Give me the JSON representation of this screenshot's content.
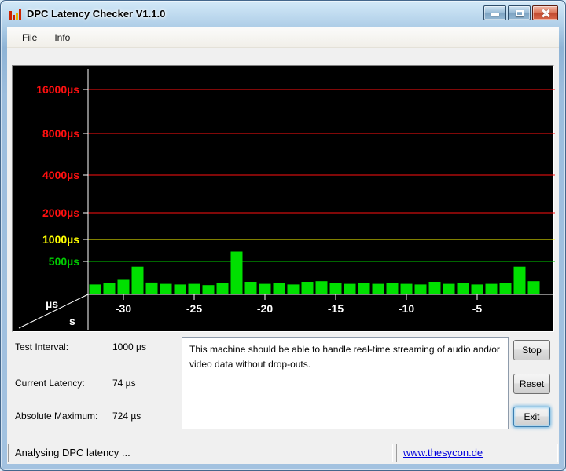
{
  "window": {
    "title": "DPC Latency Checker V1.1.0"
  },
  "menu": {
    "items": [
      "File",
      "Info"
    ]
  },
  "chart_data": {
    "type": "bar",
    "xlabel": "s",
    "ylabel": "µs",
    "x_range": [
      -32.5,
      0.5
    ],
    "ylim": [
      0,
      16000
    ],
    "x_ticks": [
      -30,
      -25,
      -20,
      -15,
      -10,
      -5
    ],
    "gridlines": [
      {
        "value": 16000,
        "label": "16000µs",
        "color": "#ff1010"
      },
      {
        "value": 8000,
        "label": "8000µs",
        "color": "#ff1010"
      },
      {
        "value": 4000,
        "label": "4000µs",
        "color": "#ff1010"
      },
      {
        "value": 2000,
        "label": "2000µs",
        "color": "#ff1010"
      },
      {
        "value": 1000,
        "label": "1000µs",
        "color": "#ffff00"
      },
      {
        "value": 500,
        "label": "500µs",
        "color": "#00cc00"
      }
    ],
    "bar_color": "#00e000",
    "bars": {
      "x": [
        -32,
        -31,
        -30,
        -29,
        -28,
        -27,
        -26,
        -25,
        -24,
        -23,
        -22,
        -21,
        -20,
        -19,
        -18,
        -17,
        -16,
        -15,
        -14,
        -13,
        -12,
        -11,
        -10,
        -9,
        -8,
        -7,
        -6,
        -5,
        -4,
        -3,
        -2,
        -1
      ],
      "values": [
        150,
        170,
        220,
        420,
        180,
        160,
        150,
        160,
        140,
        170,
        724,
        190,
        160,
        170,
        150,
        190,
        200,
        170,
        160,
        170,
        160,
        170,
        160,
        150,
        190,
        160,
        170,
        150,
        160,
        170,
        420,
        200
      ]
    }
  },
  "stats": [
    {
      "label": "Test Interval:",
      "value": "1000 µs"
    },
    {
      "label": "Current Latency:",
      "value": "74 µs"
    },
    {
      "label": "Absolute Maximum:",
      "value": "724 µs"
    }
  ],
  "info_box": {
    "text": "This machine should be able to handle real-time streaming of audio and/or video data without drop-outs."
  },
  "buttons": [
    {
      "label": "Stop"
    },
    {
      "label": "Reset"
    },
    {
      "label": "Exit"
    }
  ],
  "status_bar": {
    "text": "Analysing DPC latency ...",
    "link": "www.thesycon.de"
  },
  "colors": {
    "bar_green": "#00e000",
    "grid_red": "#ff1010",
    "grid_yellow": "#ffff00",
    "grid_green": "#00cc00",
    "axis_white": "#ffffff",
    "chart_bg": "#000000"
  }
}
